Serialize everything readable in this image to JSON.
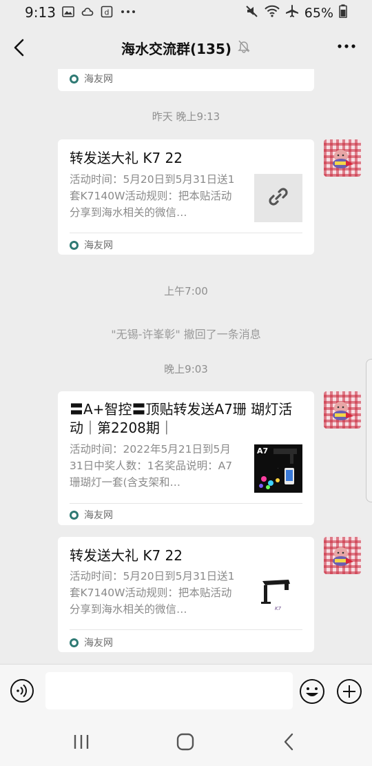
{
  "status_bar": {
    "time": "9:13",
    "battery": "65%",
    "icons": [
      "gallery-icon",
      "cloud-icon",
      "d-app-icon",
      "more-dots-icon",
      "mute-icon",
      "wifi-icon",
      "airplane-icon",
      "battery-icon"
    ]
  },
  "header": {
    "title": "海水交流群(135)",
    "icons": [
      "back-icon",
      "mute-bell-icon",
      "more-icon"
    ]
  },
  "messages": {
    "card0": {
      "source": "海友网"
    },
    "ts1": "昨天 晚上9:13",
    "card1": {
      "title": "转发送大礼 K7 22",
      "desc": "活动时间：5月20日到5月31日送1套K7140W活动规则：把本贴活动分享到海水相关的微信…",
      "source": "海友网",
      "thumb": "link-icon"
    },
    "ts2": "上午7:00",
    "system": "\"无锡-许峯彰\" 撤回了一条消息",
    "ts3": "晚上9:03",
    "card2": {
      "title": "〓A+智控〓顶贴转发送A7珊 瑚灯活动｜第2208期｜",
      "desc": "活动时间：2022年5月21日到5月31日中奖人数：1名奖品说明：A7珊瑚灯一套(含支架和…",
      "source": "海友网",
      "thumb_label": "A7"
    },
    "card3": {
      "title": "转发送大礼 K7 22",
      "desc": "活动时间：5月20日到5月31日送1套K7140W活动规则：把本贴活动分享到海水相关的微信…",
      "source": "海友网",
      "thumb_label": "K7"
    }
  },
  "input_bar": {
    "placeholder": "",
    "icons": [
      "voice-icon",
      "emoji-icon",
      "plus-icon"
    ]
  },
  "colors": {
    "background": "#ededed",
    "card": "#ffffff",
    "muted_text": "#8a8a8a",
    "avatar_check": "#c8283c",
    "source_icon": "#2f7a74"
  }
}
